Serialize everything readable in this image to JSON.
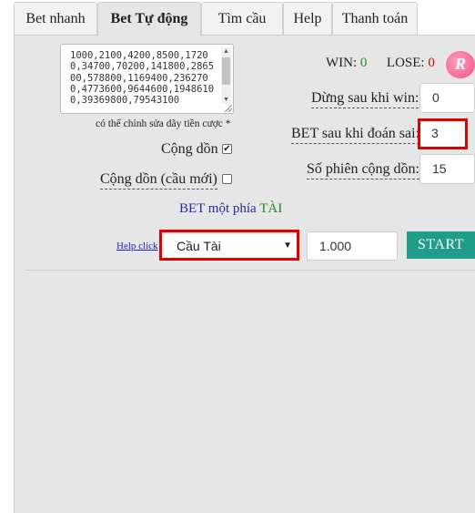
{
  "tabs": [
    {
      "label": "Bet nhanh",
      "active": false
    },
    {
      "label": "Bet Tự động",
      "active": true
    },
    {
      "label": "Tìm cầu",
      "active": false
    },
    {
      "label": "Help",
      "active": false
    },
    {
      "label": "Thanh toán",
      "active": false
    }
  ],
  "sequence": {
    "value": "1000,2100,4200,8500,17200,34700,70200,141800,286500,578800,1169400,2362700,4773600,9644600,19486100,39369800,79543100",
    "note": "có thể chỉnh sửa dãy tiền cược *"
  },
  "stats": {
    "win_label": "WIN:",
    "win_value": "0",
    "lose_label": "LOSE:",
    "lose_value": "0",
    "win_color": "#1e8a1e",
    "lose_color": "#e00000"
  },
  "options": {
    "cong_don_label": "Cộng dồn",
    "cong_don_checked": true,
    "cong_don_moi_label": "Cộng dồn (cầu mới)",
    "cong_don_moi_checked": false,
    "stop_after_win_label": "Dừng sau khi win:",
    "stop_after_win_value": "0",
    "bet_after_lose_label": "BET sau khi đoán sai:",
    "bet_after_lose_value": "3",
    "accumulate_sessions_label": "Số phiên cộng dồn:",
    "accumulate_sessions_value": "15"
  },
  "bet_side": {
    "prefix": "BET một phía",
    "side": "TÀI"
  },
  "controls": {
    "help_link": "Help click",
    "selected_pattern": "Cầu Tài",
    "amount": "1.000",
    "start_label": "START"
  },
  "colors": {
    "accent": "#1f9d8a",
    "highlight": "#e00000"
  }
}
